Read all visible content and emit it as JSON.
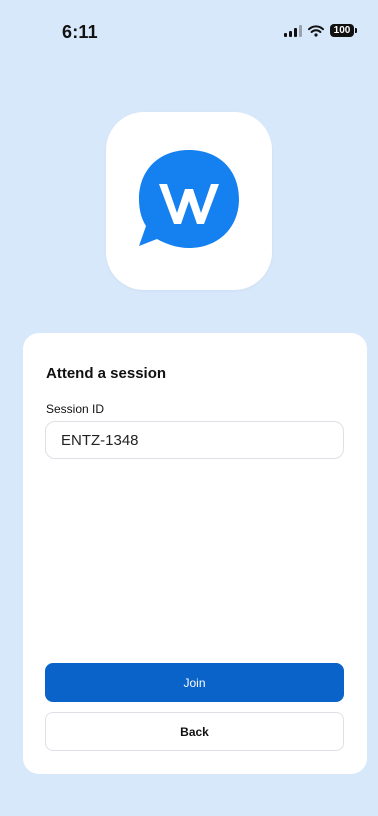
{
  "status_bar": {
    "time": "6:11",
    "battery": "100",
    "icons": [
      "signal-icon",
      "wifi-icon",
      "battery-icon"
    ]
  },
  "logo": {
    "letter": "W",
    "brand_color": "#1581f0",
    "background_color": "#ffffff"
  },
  "card": {
    "title": "Attend a session",
    "session_id_label": "Session ID",
    "session_id_value": "ENTZ-1348",
    "join_label": "Join",
    "back_label": "Back"
  },
  "colors": {
    "page_background": "#d8e8fb",
    "primary_button": "#0a63c9"
  }
}
